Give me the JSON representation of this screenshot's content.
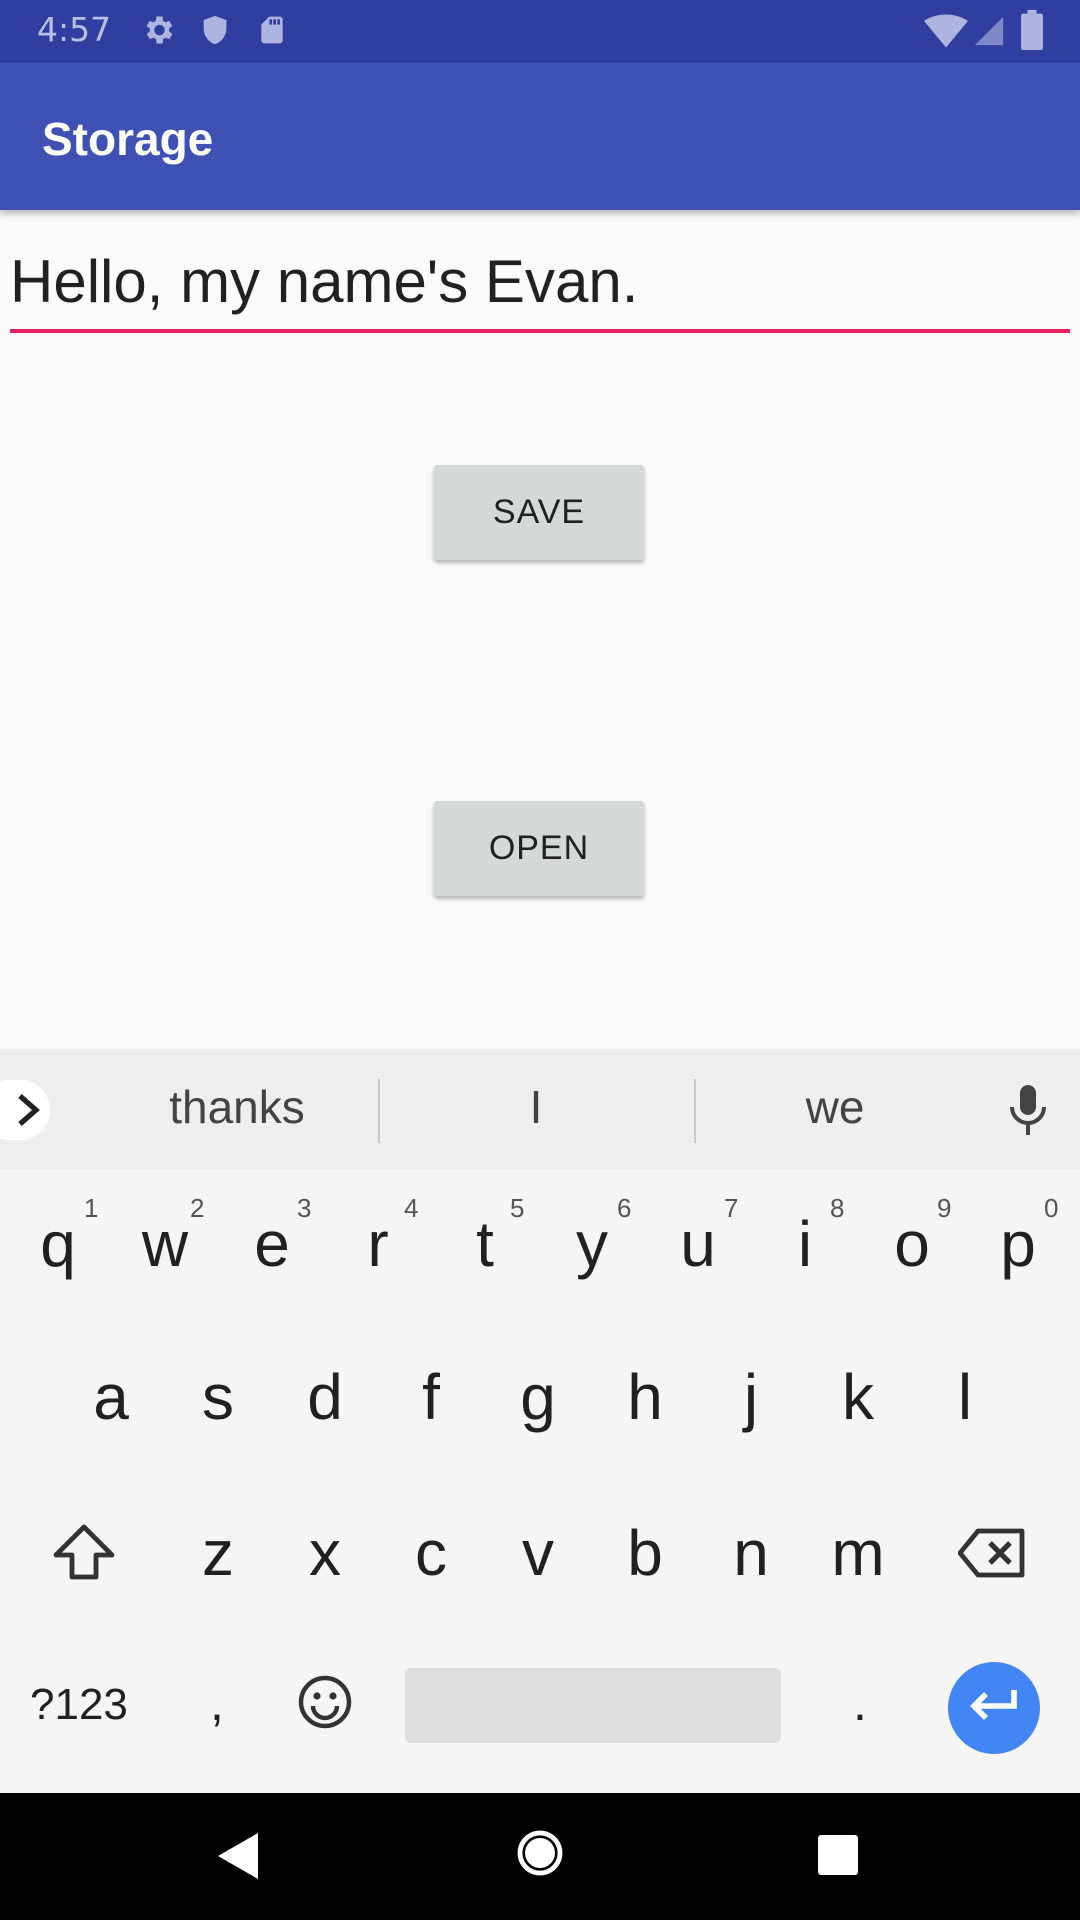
{
  "status_bar": {
    "time": "4:57",
    "left_icons": [
      "gear-icon",
      "shield-icon",
      "sd-card-icon"
    ],
    "right_icons": [
      "wifi-icon",
      "signal-icon",
      "battery-icon"
    ]
  },
  "app_bar": {
    "title": "Storage"
  },
  "editor": {
    "value": "Hello, my name's Evan."
  },
  "buttons": {
    "save": "SAVE",
    "open": "OPEN"
  },
  "keyboard": {
    "suggestions": [
      "thanks",
      "I",
      "we"
    ],
    "row1": [
      "q",
      "w",
      "e",
      "r",
      "t",
      "y",
      "u",
      "i",
      "o",
      "p"
    ],
    "row1_hints": [
      "1",
      "2",
      "3",
      "4",
      "5",
      "6",
      "7",
      "8",
      "9",
      "0"
    ],
    "row2": [
      "a",
      "s",
      "d",
      "f",
      "g",
      "h",
      "j",
      "k",
      "l"
    ],
    "row3": [
      "z",
      "x",
      "c",
      "v",
      "b",
      "n",
      "m"
    ],
    "symbols_key": "?123",
    "comma_key": ",",
    "period_key": ".",
    "accent_color": "#4285f4"
  },
  "colors": {
    "status_bar": "#303f9f",
    "app_bar": "#3f51b5",
    "edit_underline": "#e91e63"
  }
}
